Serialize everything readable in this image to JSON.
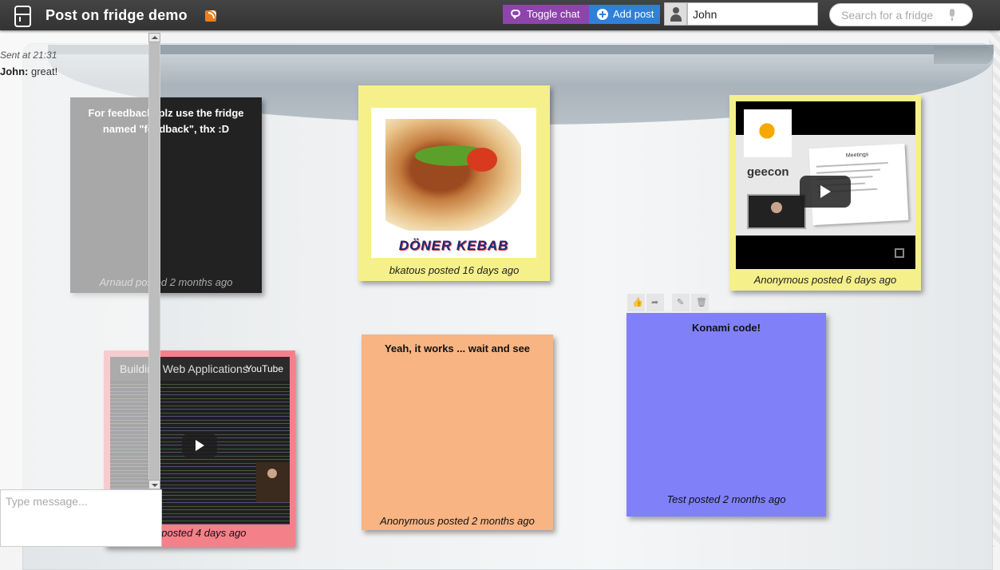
{
  "app": {
    "title": "Post on fridge demo"
  },
  "header": {
    "toggle_chat_label": "Toggle chat",
    "add_post_label": "Add post",
    "username_value": "John",
    "search_placeholder": "Search for a fridge"
  },
  "chat": {
    "sent_time": "Sent at 21:31",
    "messages": [
      {
        "author": "John:",
        "text": " great!"
      }
    ],
    "input_placeholder": "Type message..."
  },
  "posts": {
    "feedback": {
      "text": "For feedback, plz use the fridge named \"feedback\", thx :D",
      "author": "Arnaud posted 2 months ago",
      "color": "#222222"
    },
    "kebab": {
      "image_caption": "DÖNER KEBAB",
      "author": "bkatous posted 16 days ago",
      "color": "#f6f08a"
    },
    "geecon": {
      "slide_title": "Meetings",
      "brand": "geecon",
      "author": "Anonymous posted 6 days ago",
      "color": "#f6f08a"
    },
    "konami": {
      "title": "Konami code!",
      "author": "Test posted 2 months ago",
      "color": "#8080f8"
    },
    "works": {
      "title": "Yeah, it works ... wait and see",
      "author": "Anonymous posted 2 months ago",
      "color": "#f8b482"
    },
    "youtube": {
      "video_title": "Building Web Applications",
      "video_source": "YouTube",
      "author": "o posted 4 days ago",
      "color": "#f4808a"
    }
  },
  "colors": {
    "chat_button": "#8e44ad",
    "add_button": "#2f80d8",
    "topbar": "#3a3a3a",
    "rss": "#f07d1a"
  },
  "icons": [
    "fridge-icon",
    "rss-icon",
    "chat-icon",
    "plus-circle-icon",
    "user-icon",
    "mic-icon",
    "play-icon",
    "fullscreen-icon",
    "thumbs-up-icon",
    "share-icon",
    "edit-icon",
    "trash-icon"
  ]
}
